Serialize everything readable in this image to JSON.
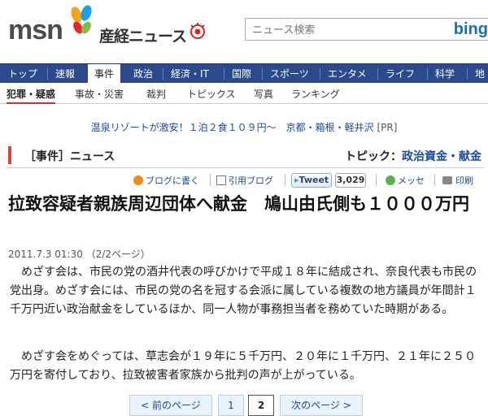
{
  "header": {
    "logo_msn": "msn",
    "logo_sankei": "産経ニュース",
    "search_placeholder": "ニュース検索",
    "search_brand": "bing"
  },
  "nav": {
    "items": [
      "トップ",
      "速報",
      "事件",
      "政治",
      "経済・IT",
      "国際",
      "スポーツ",
      "エンタメ",
      "ライフ",
      "科学",
      "地"
    ],
    "active": "事件"
  },
  "subnav": {
    "items": [
      "犯罪・疑惑",
      "事故・災害",
      "裁判",
      "トピックス",
      "写真",
      "ランキング"
    ],
    "active": "犯罪・疑惑"
  },
  "pr": {
    "link": "温泉リゾートが激安！１泊２食１０９円〜　京都・箱根・軽井沢",
    "tag": "[PR]"
  },
  "section": {
    "title": "［事件］ニュース",
    "topic_label": "トピック：",
    "topic_link": "政治資金・献金"
  },
  "tools": {
    "blog": "ブログに書く",
    "quote": "引用ブログ",
    "tweet": "Tweet",
    "tweet_count": "3,029",
    "messe": "メッセ",
    "print": "印刷"
  },
  "article": {
    "headline": "拉致容疑者親族周辺団体へ献金　鳩山由氏側も１０００万円",
    "dateline": "2011.7.3 01:30 （2/2ページ）",
    "paragraphs": [
      "めざす会は、市民の党の酒井代表の呼びかけで平成１８年に結成され、奈良代表も市民の党出身。めざす会には、市民の党の名を冠する会派に属している複数の地方議員が年間計１千万円近い政治献金をしているほか、同一人物が事務担当者を務めていた時期がある。",
      "めざす会をめぐっては、草志会が１９年に５千万円、２０年に１千万円、２１年に２５０万円を寄付しており、拉致被害者家族から批判の声が上がっている。"
    ]
  },
  "pager": {
    "prev": "< 前のページ",
    "page1": "1",
    "page2": "2",
    "next": "次のページ >"
  },
  "colors": {
    "nav_bg": "#2b4a8c",
    "link": "#1a4aa0",
    "section_accent": "#dd4433"
  }
}
